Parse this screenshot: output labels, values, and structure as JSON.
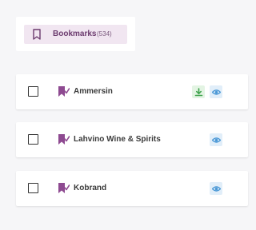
{
  "header": {
    "label": "Bookmarks",
    "count": "(534)",
    "icon": "bookmark-icon"
  },
  "items": [
    {
      "name": "Ammersin",
      "icon": "bookmark-check-icon",
      "actions": [
        "download-icon",
        "eye-icon"
      ]
    },
    {
      "name": "Lahvino Wine & Spirits",
      "icon": "bookmark-check-icon",
      "actions": [
        "eye-icon"
      ]
    },
    {
      "name": "Kobrand",
      "icon": "bookmark-check-icon",
      "actions": [
        "eye-icon"
      ]
    }
  ],
  "colors": {
    "accent": "#8e4a91",
    "pill_bg": "#f1e6f1",
    "download": "#3fa34d",
    "eye": "#4a98d6"
  }
}
